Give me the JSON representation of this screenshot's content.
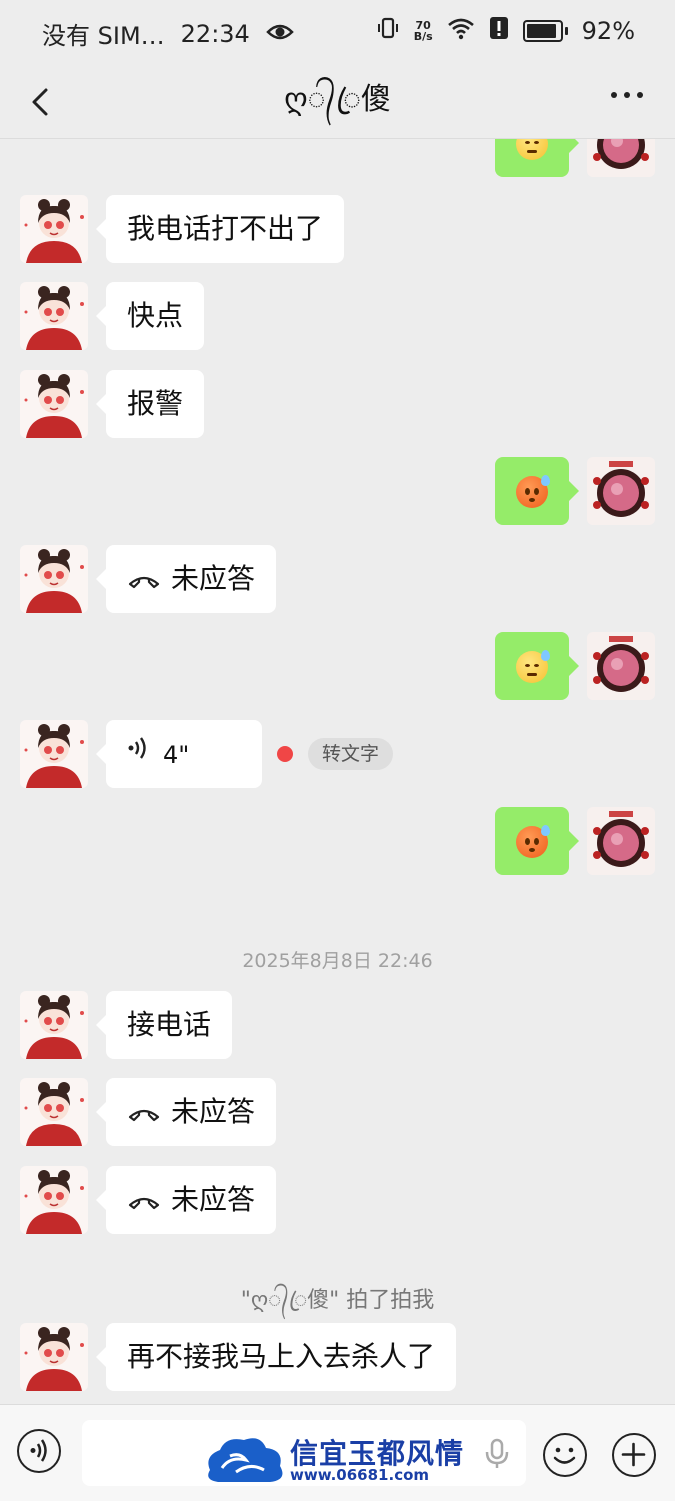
{
  "status_bar": {
    "carrier": "没有 SIM…",
    "time": "22:34",
    "net_speed_value": "70",
    "net_speed_unit": "B/s",
    "battery": "92%",
    "battery_level": 0.92
  },
  "header": {
    "title": "ღ᭄ꦿ傻",
    "back_icon": "chevron-left-icon",
    "more_icon": "more-dots-icon"
  },
  "messages": [
    {
      "side": "left",
      "type": "text",
      "text": "我电话打不出了"
    },
    {
      "side": "left",
      "type": "text",
      "text": "快点"
    },
    {
      "side": "left",
      "type": "text",
      "text": "报警"
    },
    {
      "side": "right",
      "type": "emoji",
      "emoji": "sweat-face"
    },
    {
      "side": "left",
      "type": "call",
      "text": "未应答"
    },
    {
      "side": "right",
      "type": "emoji",
      "emoji": "unamused-face"
    },
    {
      "side": "left",
      "type": "voice",
      "duration": "4\"",
      "to_text_label": "转文字"
    },
    {
      "side": "right",
      "type": "emoji",
      "emoji": "sweat-face"
    },
    {
      "type": "timestamp",
      "text": "2025年8月8日 22:46"
    },
    {
      "side": "left",
      "type": "text",
      "text": "接电话"
    },
    {
      "side": "left",
      "type": "call",
      "text": "未应答"
    },
    {
      "side": "left",
      "type": "call",
      "text": "未应答"
    },
    {
      "type": "system",
      "text": "\"ღ᭄ꦿ傻\" 拍了拍我"
    },
    {
      "side": "left",
      "type": "text",
      "text": "再不接我马上入去杀人了"
    }
  ],
  "watermark": {
    "title": "信宜玉都风情",
    "url": "www.06681.com"
  },
  "colors": {
    "background": "#ededed",
    "bubble_in": "#ffffff",
    "bubble_out": "#95ec69",
    "unread_dot": "#f04646"
  }
}
